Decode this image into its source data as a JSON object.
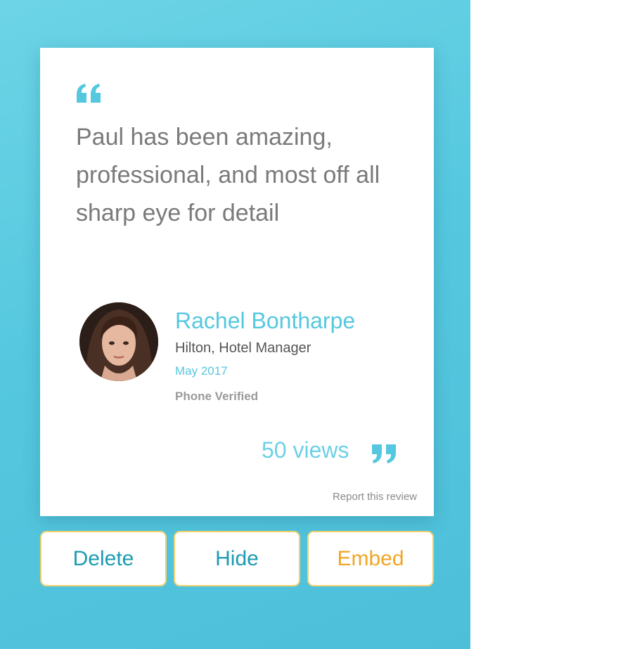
{
  "review": {
    "text": "Paul has been amazing, professional, and most off all sharp eye for detail",
    "reviewer_name": "Rachel Bontharpe",
    "reviewer_role": "Hilton, Hotel Manager",
    "date": "May 2017",
    "verification": "Phone Verified",
    "views": "50 views",
    "report_link": "Report this review"
  },
  "actions": {
    "delete_label": "Delete",
    "hide_label": "Hide",
    "embed_label": "Embed"
  },
  "icons": {
    "open_quote": "open-quote-icon",
    "close_quote": "close-quote-icon",
    "avatar": "reviewer-photo"
  },
  "colors": {
    "accent": "#55c8df",
    "button_border": "#f3cf6e",
    "delete_text": "#1d9bb2",
    "hide_text": "#1d9bb2",
    "embed_text": "#f0a623",
    "body_text": "#7a7a7a"
  }
}
